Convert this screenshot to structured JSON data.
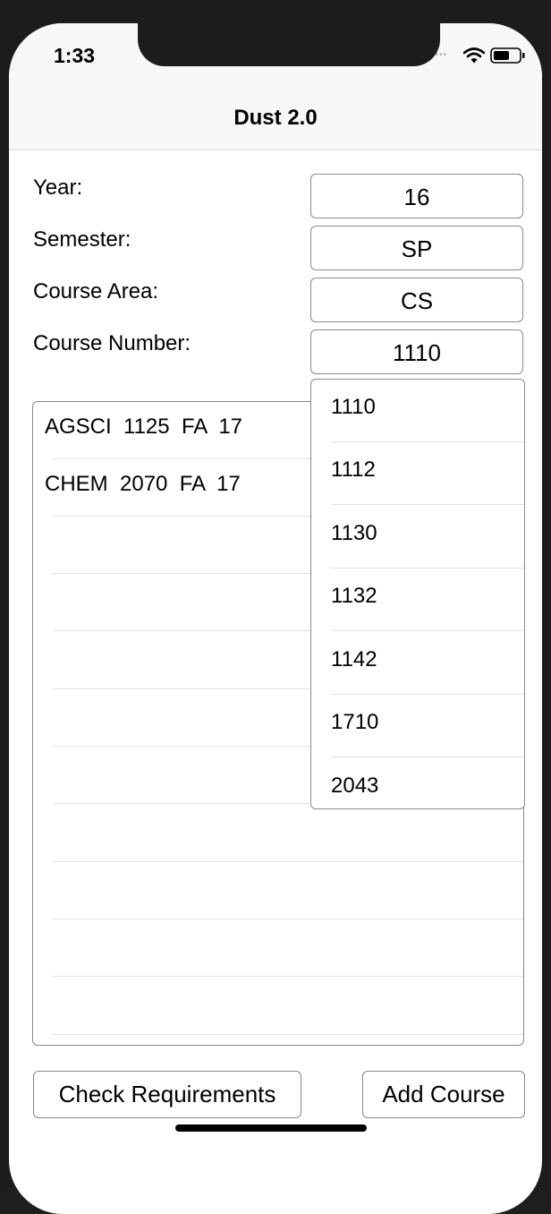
{
  "status_bar": {
    "time": "1:33",
    "signal_dots": "••••",
    "icons": [
      "wifi-icon",
      "battery-icon"
    ]
  },
  "nav": {
    "title": "Dust 2.0"
  },
  "form": {
    "year_label": "Year:",
    "year_value": "16",
    "semester_label": "Semester:",
    "semester_value": "SP",
    "area_label": "Course Area:",
    "area_value": "CS",
    "number_label": "Course Number:",
    "number_value": "1110"
  },
  "course_list": {
    "rows": [
      "AGSCI  1125  FA  17",
      "CHEM  2070  FA  17"
    ]
  },
  "dropdown": {
    "options": [
      "1110",
      "1112",
      "1130",
      "1132",
      "1142",
      "1710",
      "2043"
    ]
  },
  "buttons": {
    "check_requirements": "Check Requirements",
    "add_course": "Add Course"
  },
  "colors": {
    "border": "#888888",
    "nav_background": "#f7f7f7",
    "bezel": "#1c1c1c"
  }
}
